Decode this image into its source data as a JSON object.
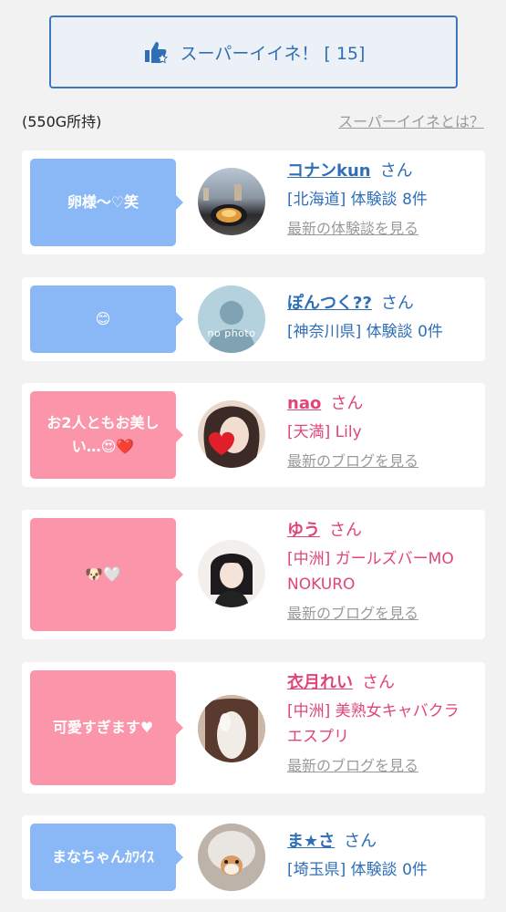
{
  "super_button": {
    "label": "スーパーイイネ！ [ 15]",
    "icon": "thumbs-up-star-icon"
  },
  "gold": "(550G所持)",
  "what_is_link": "スーパーイイネとは？",
  "san": "さん",
  "entries": [
    {
      "message": "卵様〜♡笑",
      "name": "コナンkun",
      "detail": "[北海道] 体験談 8件",
      "more": "最新の体験談を見る",
      "color": "blue"
    },
    {
      "message": "😊",
      "name": "ぽんつく??",
      "detail": "[神奈川県] 体験談 0件",
      "avatar_text": "no photo",
      "color": "blue"
    },
    {
      "message": "お2人ともお美しい…😍❤️",
      "name": "nao",
      "detail": "[天満] Lily",
      "more": "最新のブログを見る",
      "color": "pink"
    },
    {
      "message": "🐶🤍",
      "name": "ゆう",
      "detail": "[中洲] ガールズバーMONOKURO",
      "more": "最新のブログを見る",
      "color": "pink"
    },
    {
      "message": "可愛すぎます♥",
      "name": "衣月れい",
      "detail": "[中洲] 美熟女キャバクラ エスプリ",
      "more": "最新のブログを見る",
      "color": "pink"
    },
    {
      "message": "まなちゃんｶﾜｲｽ",
      "name": "ま★さ",
      "detail": "[埼玉県] 体験談 0件",
      "color": "blue"
    }
  ],
  "colors": {
    "blue": "#2f6fb6",
    "pink": "#e0457a",
    "bubble_blue": "#8ab8f6",
    "bubble_pink": "#fb95aa"
  }
}
